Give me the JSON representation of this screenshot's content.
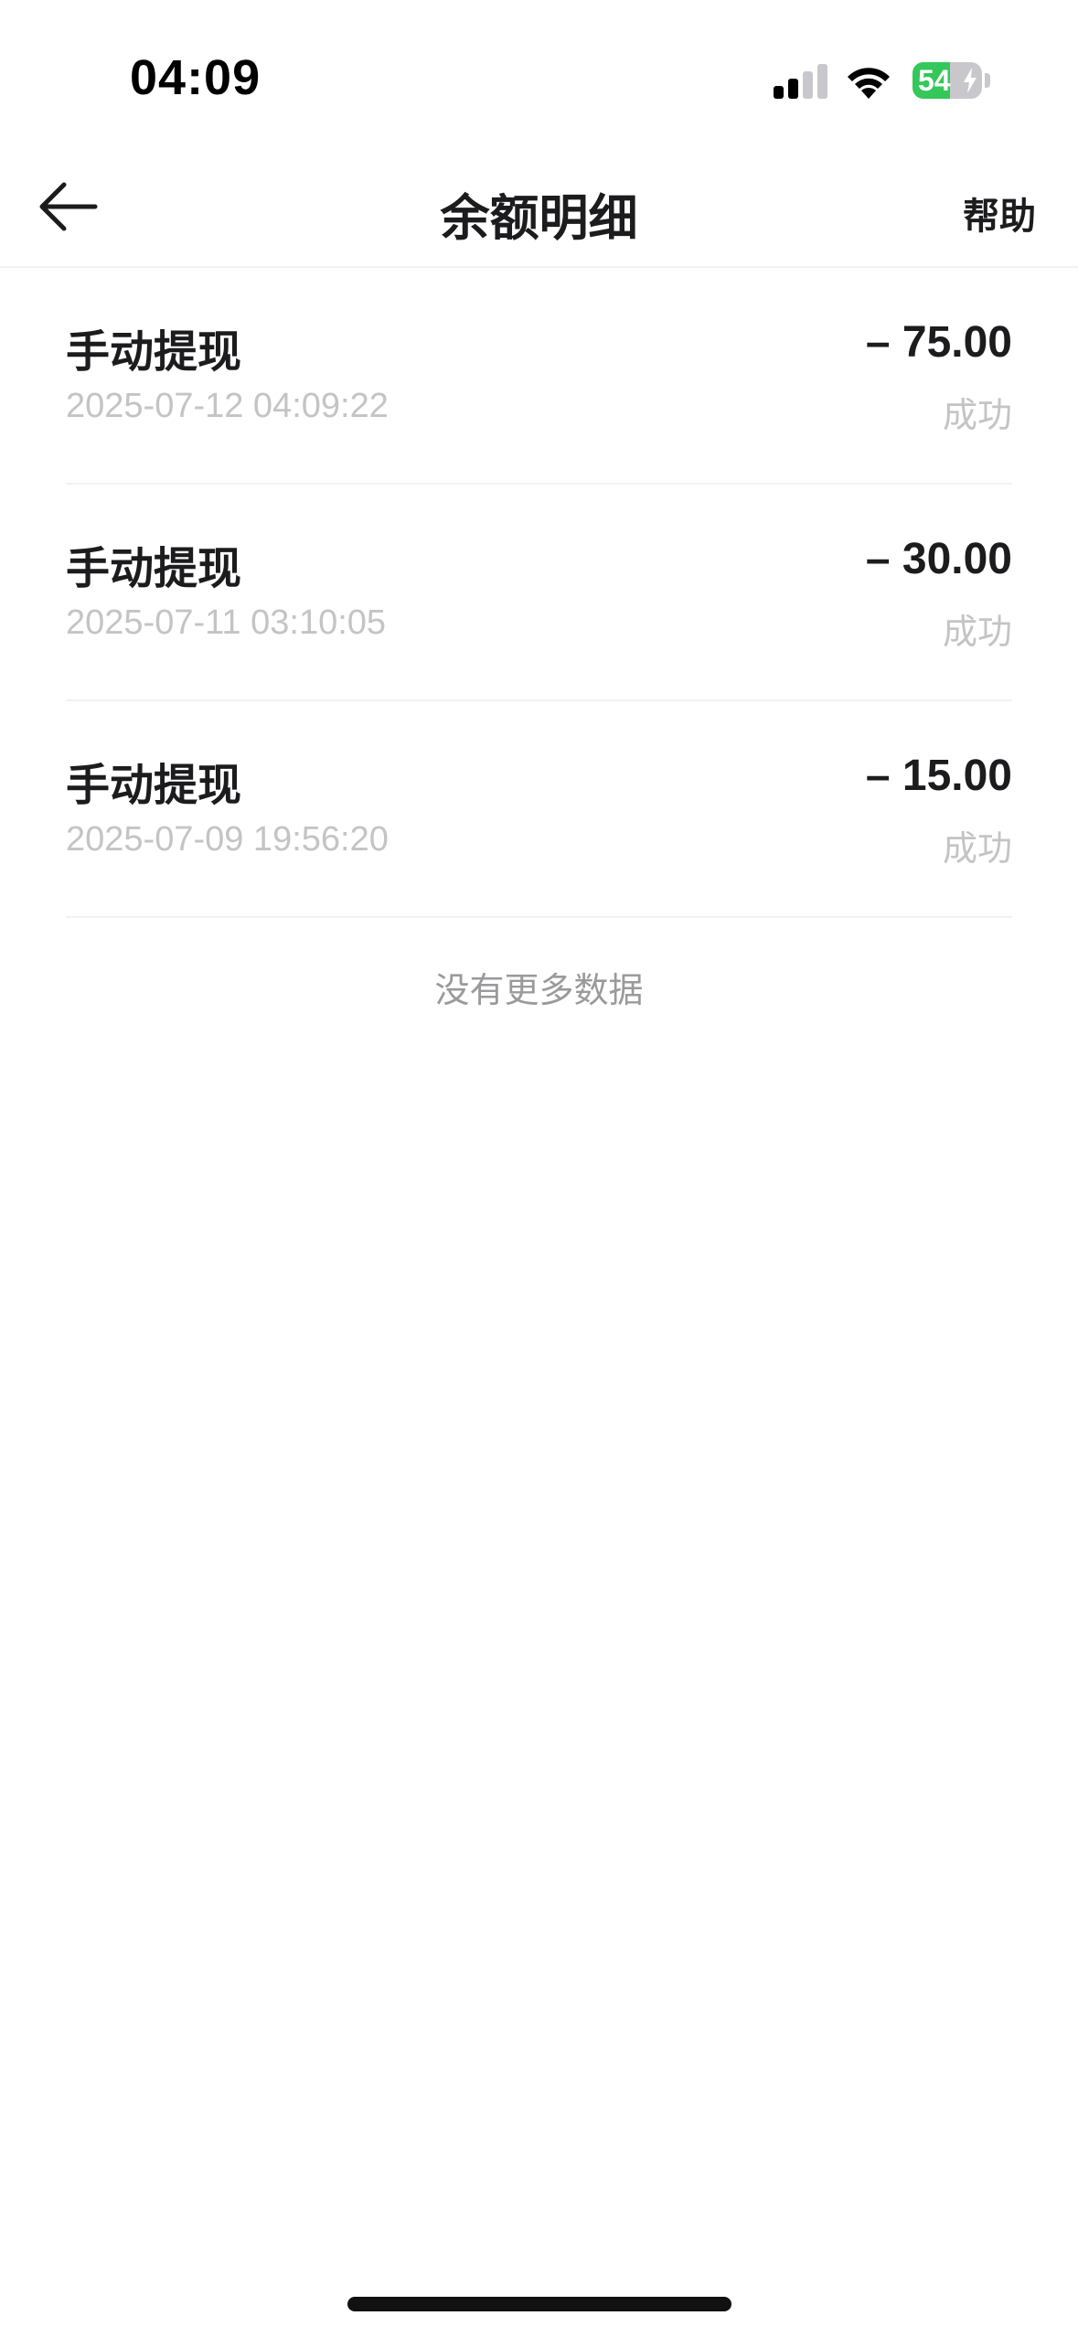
{
  "status_bar": {
    "time": "04:09",
    "battery_level": "54",
    "battery_percent": 54,
    "signal_bars_active": 2,
    "signal_bars_total": 4,
    "icons": [
      "cellular-signal-icon",
      "wifi-icon",
      "battery-charging-icon"
    ],
    "colors": {
      "battery": "#34c759"
    }
  },
  "nav": {
    "title": "余额明细",
    "help_label": "帮助",
    "back_icon": "arrow-left-icon"
  },
  "transactions": [
    {
      "title": "手动提现",
      "time": "2025-07-12 04:09:22",
      "amount": "– 75.00",
      "status": "成功"
    },
    {
      "title": "手动提现",
      "time": "2025-07-11 03:10:05",
      "amount": "– 30.00",
      "status": "成功"
    },
    {
      "title": "手动提现",
      "time": "2025-07-09 19:56:20",
      "amount": "– 15.00",
      "status": "成功"
    }
  ],
  "footer": {
    "no_more_text": "没有更多数据"
  }
}
